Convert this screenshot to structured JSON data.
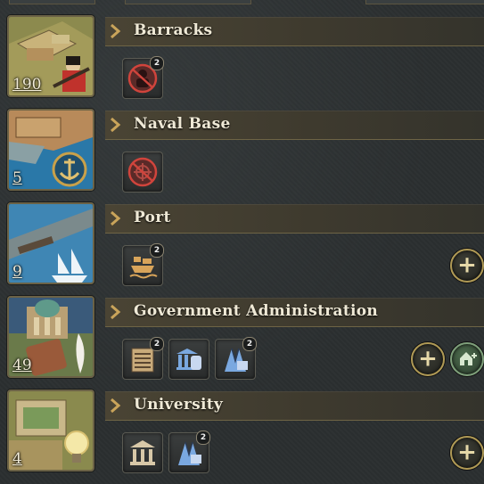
{
  "buildings": [
    {
      "name": "Barracks",
      "level": "190",
      "slots": [
        {
          "icon": "no-soldier-icon",
          "badge": "2"
        }
      ],
      "actions": []
    },
    {
      "name": "Naval Base",
      "level": "5",
      "slots": [
        {
          "icon": "no-ship-wheel-icon",
          "badge": ""
        }
      ],
      "actions": []
    },
    {
      "name": "Port",
      "level": "9",
      "slots": [
        {
          "icon": "cargo-ship-icon",
          "badge": "2"
        }
      ],
      "actions": [
        "add-level"
      ]
    },
    {
      "name": "Government Administration",
      "level": "49",
      "slots": [
        {
          "icon": "ledger-icon",
          "badge": "2"
        },
        {
          "icon": "government-scroll-icon",
          "badge": ""
        },
        {
          "icon": "praying-clergy-icon",
          "badge": "2"
        }
      ],
      "actions": [
        "add-level",
        "add-building"
      ]
    },
    {
      "name": "University",
      "level": "4",
      "slots": [
        {
          "icon": "institution-icon",
          "badge": ""
        },
        {
          "icon": "praying-clergy-icon",
          "badge": "2"
        }
      ],
      "actions": [
        "add-level"
      ]
    }
  ],
  "colors": {
    "accent": "#b09a55",
    "header": "#4a4434",
    "text": "#efe9d6"
  }
}
